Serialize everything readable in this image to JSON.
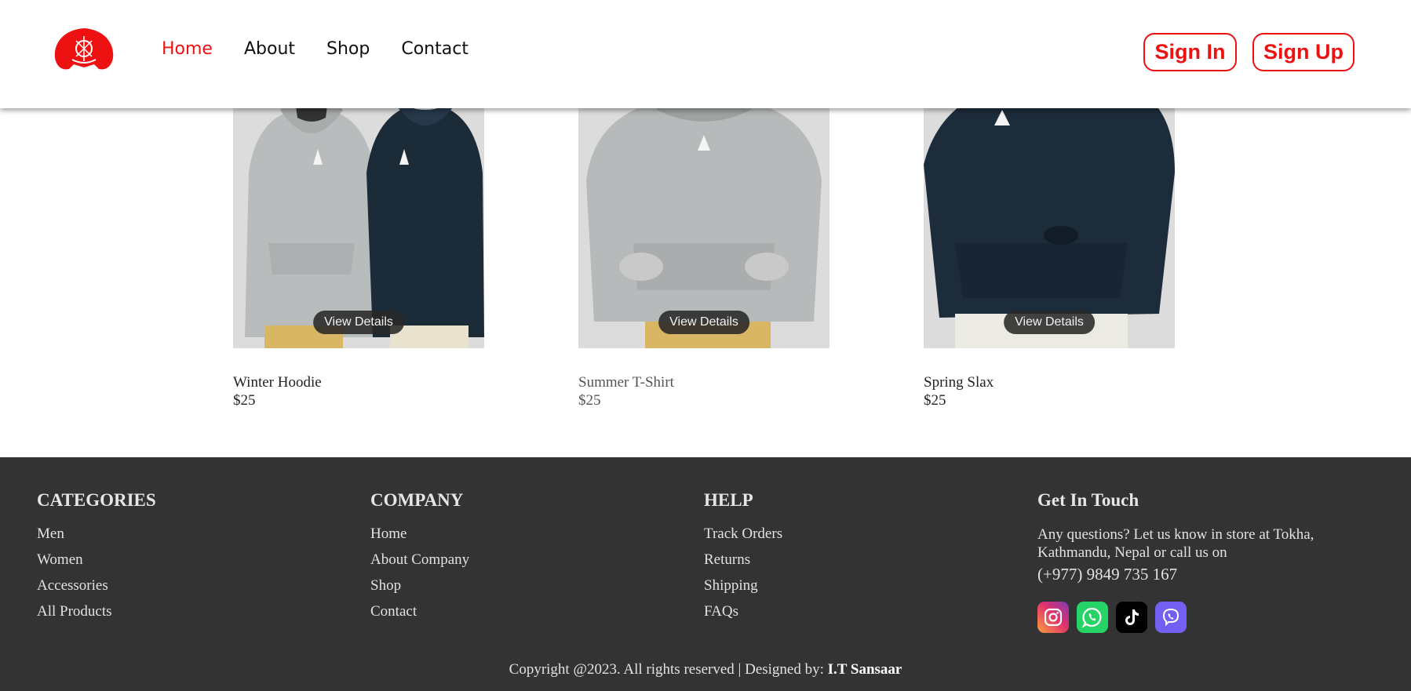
{
  "nav": {
    "items": [
      {
        "label": "Home",
        "active": true
      },
      {
        "label": "About",
        "active": false
      },
      {
        "label": "Shop",
        "active": false
      },
      {
        "label": "Contact",
        "active": false
      }
    ],
    "sign_in": "Sign In",
    "sign_up": "Sign Up"
  },
  "products": [
    {
      "name": "Winter Hoodie",
      "price": "$25",
      "button": "View Details"
    },
    {
      "name": "Summer T-Shirt",
      "price": "$25",
      "button": "View Details"
    },
    {
      "name": "Spring Slax",
      "price": "$25",
      "button": "View Details"
    }
  ],
  "footer": {
    "categories": {
      "title": "CATEGORIES",
      "links": [
        "Men",
        "Women",
        "Accessories",
        "All Products"
      ]
    },
    "company": {
      "title": "COMPANY",
      "links": [
        "Home",
        "About Company",
        "Shop",
        "Contact"
      ]
    },
    "help": {
      "title": "HELP",
      "links": [
        "Track Orders",
        "Returns",
        "Shipping",
        "FAQs"
      ]
    },
    "contact": {
      "title": "Get In Touch",
      "text": "Any questions? Let us know in store at Tokha, Kathmandu, Nepal or call us on",
      "phone": "(+977) 9849 735 167",
      "socials": [
        "instagram-icon",
        "whatsapp-icon",
        "tiktok-icon",
        "viber-icon"
      ]
    },
    "copyright_prefix": "Copyright @2023. All rights reserved | Designed by: ",
    "copyright_brand": "I.T Sansaar"
  },
  "colors": {
    "accent": "#ee1111",
    "footer_bg": "#333333"
  }
}
